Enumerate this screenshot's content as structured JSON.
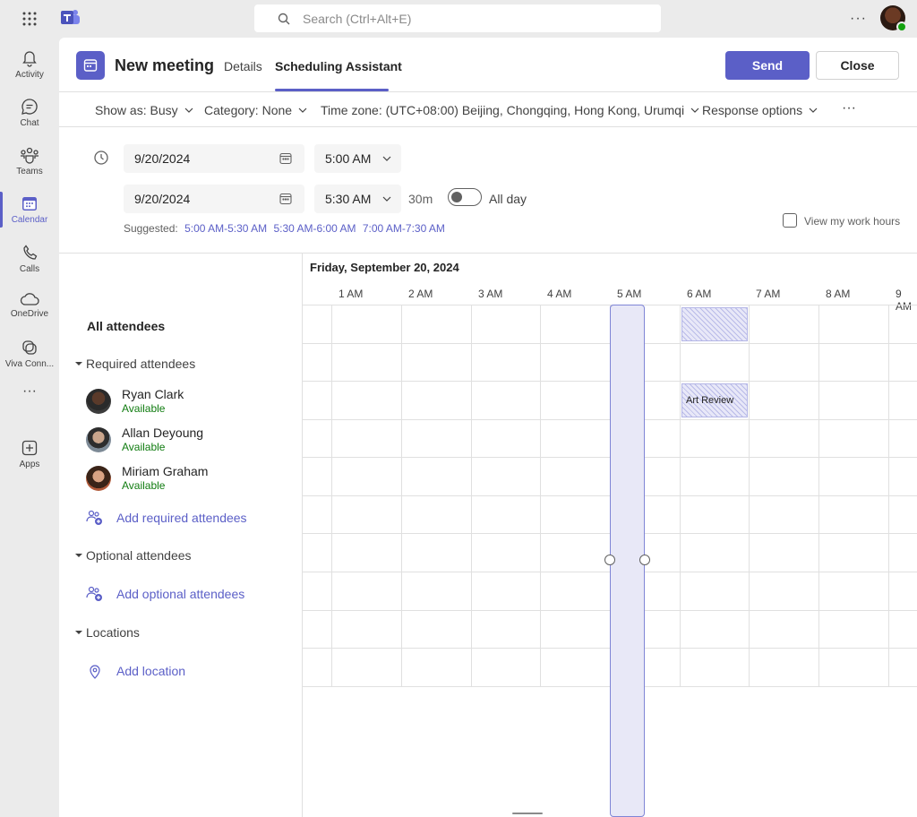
{
  "search": {
    "placeholder": "Search (Ctrl+Alt+E)"
  },
  "rail": {
    "items": [
      {
        "label": "Activity",
        "icon": "bell-icon"
      },
      {
        "label": "Chat",
        "icon": "chat-icon"
      },
      {
        "label": "Teams",
        "icon": "teams-icon"
      },
      {
        "label": "Calendar",
        "icon": "calendar-icon"
      },
      {
        "label": "Calls",
        "icon": "phone-icon"
      },
      {
        "label": "OneDrive",
        "icon": "cloud-icon"
      },
      {
        "label": "Viva Conn...",
        "icon": "viva-icon"
      },
      {
        "label": "Apps",
        "icon": "apps-icon"
      }
    ],
    "active": "Calendar"
  },
  "header": {
    "title": "New meeting",
    "tabs": [
      {
        "label": "Details"
      },
      {
        "label": "Scheduling Assistant"
      }
    ],
    "active_tab": "Scheduling Assistant",
    "send_label": "Send",
    "close_label": "Close"
  },
  "options": {
    "show_as": "Show as: Busy",
    "category": "Category: None",
    "timezone": "Time zone: (UTC+08:00) Beijing, Chongqing, Hong Kong, Urumqi",
    "response": "Response options",
    "more": "···"
  },
  "datetime": {
    "start_date": "9/20/2024",
    "start_time": "5:00 AM",
    "end_date": "9/20/2024",
    "end_time": "5:30 AM",
    "duration": "30m",
    "all_day_label": "All day",
    "all_day": false,
    "suggested_label": "Suggested:",
    "suggestions": [
      "5:00 AM-5:30 AM",
      "5:30 AM-6:00 AM",
      "7:00 AM-7:30 AM"
    ],
    "work_hours_label": "View my work hours"
  },
  "attendees": {
    "all_label": "All attendees",
    "required_label": "Required attendees",
    "required": [
      {
        "name": "Ryan Clark",
        "status": "Available"
      },
      {
        "name": "Allan Deyoung",
        "status": "Available"
      },
      {
        "name": "Miriam Graham",
        "status": "Available"
      }
    ],
    "add_required": "Add required attendees",
    "optional_label": "Optional attendees",
    "add_optional": "Add optional attendees",
    "locations_label": "Locations",
    "add_location": "Add location"
  },
  "grid": {
    "date": "Friday, September 20, 2024",
    "hours": [
      "1 AM",
      "2 AM",
      "3 AM",
      "4 AM",
      "5 AM",
      "6 AM",
      "7 AM",
      "8 AM",
      "9 AM"
    ],
    "events": [
      {
        "label": "Art Review"
      }
    ]
  },
  "colors": {
    "accent": "#5b5fc7",
    "available": "#107c10"
  }
}
